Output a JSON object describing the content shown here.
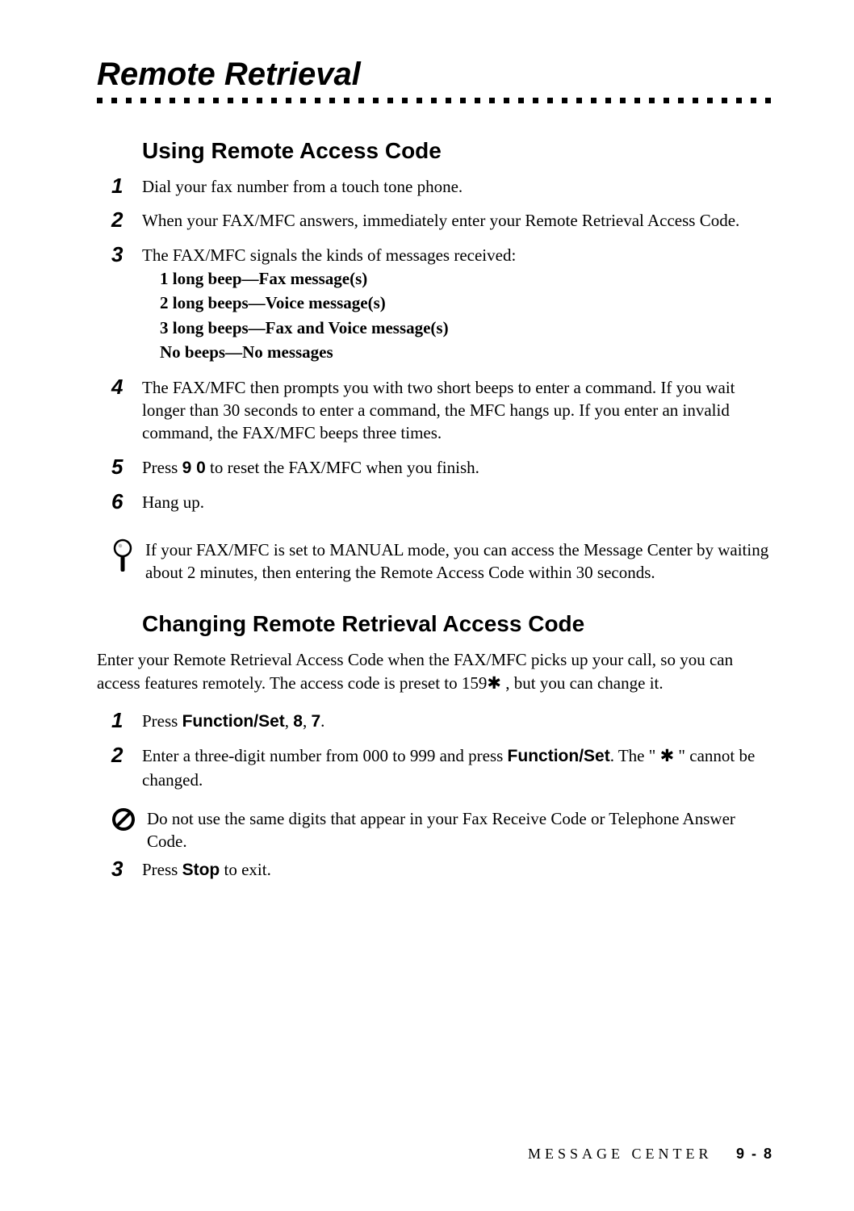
{
  "title": "Remote Retrieval",
  "section1": {
    "heading": "Using Remote Access Code",
    "steps": [
      {
        "text": "Dial your fax number from a touch tone phone."
      },
      {
        "text": "When your FAX/MFC answers, immediately enter your Remote Retrieval Access Code."
      },
      {
        "text": "The FAX/MFC signals the kinds of messages received:",
        "sublines": [
          "1 long beep—Fax message(s)",
          "2 long beeps—Voice message(s)",
          "3 long beeps—Fax and Voice message(s)",
          "No beeps—No messages"
        ]
      },
      {
        "text": "The FAX/MFC then prompts you with two short beeps to enter a command. If you wait longer than 30 seconds to enter a command, the MFC hangs up. If you enter an invalid command, the FAX/MFC beeps three times."
      },
      {
        "pre": "Press ",
        "bold": "9 0",
        "post": " to reset the FAX/MFC when you finish."
      },
      {
        "text": "Hang up."
      }
    ],
    "tip": "If your FAX/MFC is set to MANUAL mode, you can access the Message Center by waiting about 2 minutes, then entering the Remote Access Code within 30 seconds."
  },
  "section2": {
    "heading": "Changing Remote Retrieval Access Code",
    "intro_pre": "Enter your Remote Retrieval Access Code when the FAX/MFC picks up your call, so you can access features remotely. The access code is preset to 159",
    "intro_star": "✱",
    "intro_post": " , but you can change it.",
    "steps": [
      {
        "pre": "Press ",
        "bold": "Function/Set",
        "post": ", ",
        "bold2": "8",
        "post2": ", ",
        "bold3": "7",
        "post3": "."
      },
      {
        "pre": "Enter a three-digit number from 000 to 999 and press ",
        "bold": "Function/Set",
        "post": ". The \" ",
        "star": "✱",
        "post2": " \" cannot be changed."
      },
      {
        "pre": "Press ",
        "bold": "Stop",
        "post": " to exit."
      }
    ],
    "warning": "Do not use the same digits that appear in your Fax Receive Code or Telephone Answer Code."
  },
  "footer": {
    "section": "MESSAGE CENTER",
    "page": "9 - 8"
  }
}
